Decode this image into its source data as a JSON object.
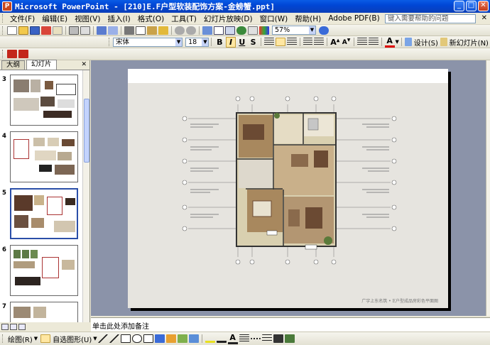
{
  "window": {
    "title": "Microsoft PowerPoint - [210]E.F户型软装配饰方案-金螃蟹.ppt]",
    "buttons": {
      "minimize": "_",
      "maximize": "□",
      "close": "✕"
    }
  },
  "menu": {
    "items": [
      "文件(F)",
      "编辑(E)",
      "视图(V)",
      "插入(I)",
      "格式(O)",
      "工具(T)",
      "幻灯片放映(D)",
      "窗口(W)",
      "帮助(H)",
      "Adobe PDF(B)"
    ],
    "help_placeholder": "键入需要帮助的问题",
    "close_glyph": "✕"
  },
  "toolbar_standard": {
    "zoom": "57%"
  },
  "toolbar_format": {
    "font_name": "宋体",
    "font_size": "18",
    "bold": "B",
    "italic": "I",
    "underline": "U",
    "shadow": "S",
    "font_color_glyph": "A",
    "design_label": "设计(S)",
    "new_slide_label": "新幻灯片(N)"
  },
  "left_pane": {
    "tabs": [
      "大纲",
      "幻灯片"
    ],
    "active_tab": "幻灯片",
    "close_glyph": "✕",
    "slides": [
      {
        "number": "3"
      },
      {
        "number": "4"
      },
      {
        "number": "5"
      },
      {
        "number": "6"
      },
      {
        "number": "7"
      }
    ]
  },
  "slide": {
    "caption": "广宇上东名筑 • E户型成品房彩色平面图"
  },
  "notes": {
    "placeholder": "单击此处添加备注"
  },
  "draw_toolbar": {
    "draw_label": "绘图(R)",
    "autoshapes_label": "自选图形(U)"
  },
  "colors": {
    "titlebar": "#0a5ce6",
    "workspace": "#8b93a9",
    "chrome": "#ece9d8"
  }
}
